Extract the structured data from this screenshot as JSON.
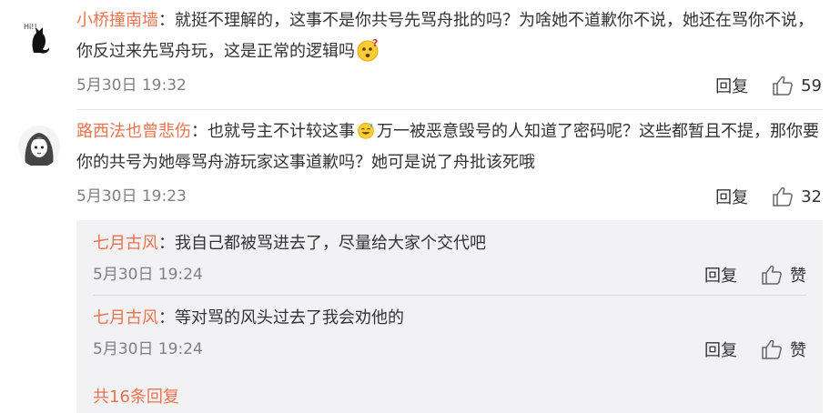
{
  "comments": [
    {
      "username": "小桥撞南墙",
      "text_before_emoji": "就挺不理解的，这事不是你共号先骂舟批的吗？为啥她不道歉你不说，她还在骂你不说，你反过来先骂舟玩，这是正常的逻辑吗",
      "emoji": "thinking-question-emoji",
      "timestamp": "5月30日 19:32",
      "reply_label": "回复",
      "likes": "59"
    },
    {
      "username": "路西法也曾悲伤",
      "text_before_emoji": "也就号主不计较这事",
      "emoji": "sweat-smile-emoji",
      "text_after_emoji": "万一被恶意毁号的人知道了密码呢？这些都暂且不提，那你要你的共号为她辱骂舟游玩家这事道歉吗？她可是说了舟批该死哦",
      "timestamp": "5月30日 19:23",
      "reply_label": "回复",
      "likes": "32",
      "replies": [
        {
          "username": "七月古风",
          "text": "我自己都被骂进去了，尽量给大家个交代吧",
          "timestamp": "5月30日 19:24",
          "reply_label": "回复",
          "like_label": "赞"
        },
        {
          "username": "七月古风",
          "text": "等对骂的风头过去了我会劝他的",
          "timestamp": "5月30日 19:24",
          "reply_label": "回复",
          "like_label": "赞"
        }
      ],
      "more_replies": "共16条回复"
    }
  ],
  "colon": "：",
  "colors": {
    "username": "#eb7350",
    "meta": "#808080",
    "reply_bg": "#f2f2f5"
  }
}
